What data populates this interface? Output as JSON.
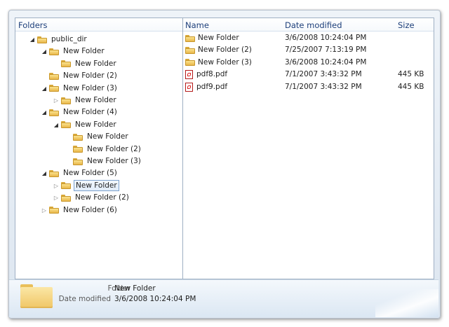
{
  "tree": {
    "header": "Folders",
    "nodes": [
      {
        "label": "public_dir",
        "depth": 0,
        "arrow": "expanded"
      },
      {
        "label": "New Folder",
        "depth": 1,
        "arrow": "expanded"
      },
      {
        "label": "New Folder",
        "depth": 2,
        "arrow": "none"
      },
      {
        "label": "New Folder (2)",
        "depth": 1,
        "arrow": "none"
      },
      {
        "label": "New Folder (3)",
        "depth": 1,
        "arrow": "expanded"
      },
      {
        "label": "New Folder",
        "depth": 2,
        "arrow": "collapsed"
      },
      {
        "label": "New Folder (4)",
        "depth": 1,
        "arrow": "expanded"
      },
      {
        "label": "New Folder",
        "depth": 2,
        "arrow": "expanded"
      },
      {
        "label": "New Folder",
        "depth": 3,
        "arrow": "none"
      },
      {
        "label": "New Folder (2)",
        "depth": 3,
        "arrow": "none"
      },
      {
        "label": "New Folder (3)",
        "depth": 3,
        "arrow": "none"
      },
      {
        "label": "New Folder (5)",
        "depth": 1,
        "arrow": "expanded"
      },
      {
        "label": "New Folder",
        "depth": 2,
        "arrow": "collapsed",
        "selected": true
      },
      {
        "label": "New Folder (2)",
        "depth": 2,
        "arrow": "collapsed"
      },
      {
        "label": "New Folder (6)",
        "depth": 1,
        "arrow": "collapsed"
      }
    ]
  },
  "list": {
    "columns": {
      "name": "Name",
      "date": "Date modified",
      "size": "Size"
    },
    "rows": [
      {
        "icon": "folder-icon",
        "name": "New Folder",
        "date": "3/6/2008 10:24:04 PM",
        "size": ""
      },
      {
        "icon": "folder-icon",
        "name": "New Folder (2)",
        "date": "7/25/2007 7:13:19 PM",
        "size": ""
      },
      {
        "icon": "folder-icon",
        "name": "New Folder (3)",
        "date": "3/6/2008 10:24:04 PM",
        "size": ""
      },
      {
        "icon": "pdf-icon",
        "name": "pdf8.pdf",
        "date": "7/1/2007 3:43:32 PM",
        "size": "445 KB"
      },
      {
        "icon": "pdf-icon",
        "name": "pdf9.pdf",
        "date": "7/1/2007 3:43:32 PM",
        "size": "445 KB"
      }
    ]
  },
  "details": {
    "icon": "folder-icon",
    "folder_key": "Folder",
    "folder_val": "New Folder",
    "date_key": "Date modified",
    "date_val": "3/6/2008 10:24:04 PM"
  }
}
